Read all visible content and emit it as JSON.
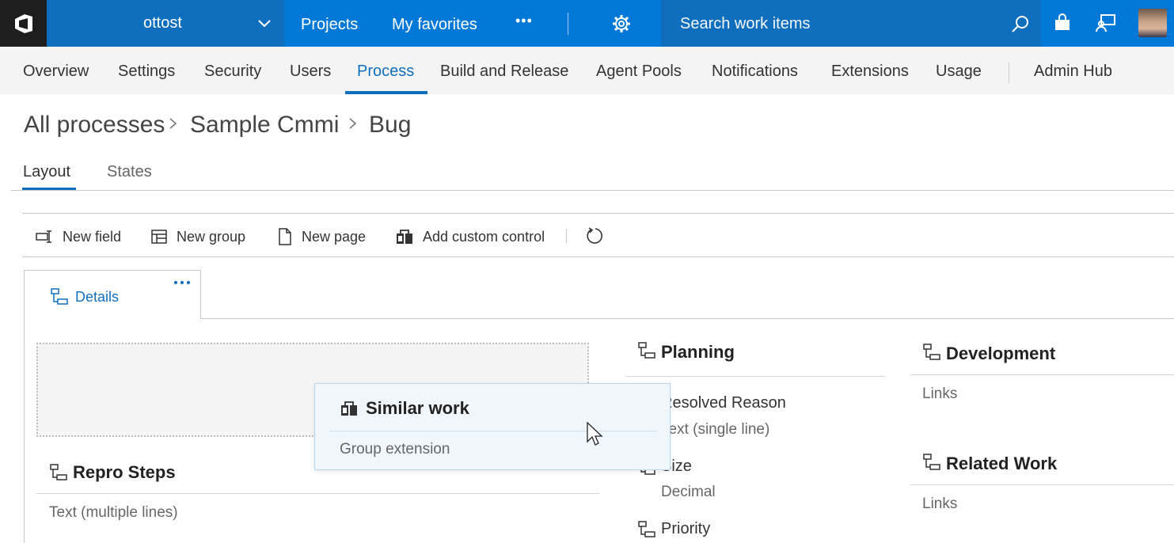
{
  "topbar": {
    "account_name": "ottost",
    "nav": {
      "projects": "Projects",
      "favorites": "My favorites",
      "more": "•••"
    },
    "search_placeholder": "Search work items",
    "accent_color": "#0078d7"
  },
  "hubs": {
    "items": [
      "Overview",
      "Settings",
      "Security",
      "Users",
      "Process",
      "Build and Release",
      "Agent Pools",
      "Notifications",
      "Extensions",
      "Usage"
    ],
    "active": "Process",
    "admin_hub": "Admin Hub"
  },
  "breadcrumb": {
    "root": "All processes",
    "process": "Sample Cmmi",
    "wit": "Bug"
  },
  "pivots": {
    "layout": "Layout",
    "states": "States"
  },
  "toolbar": {
    "new_field": "New field",
    "new_group": "New group",
    "new_page": "New page",
    "add_custom_control": "Add custom control"
  },
  "page_tab": {
    "label": "Details"
  },
  "groups": {
    "repro_steps": {
      "title": "Repro Steps",
      "type": "Text (multiple lines)"
    },
    "planning": {
      "title": "Planning",
      "fields": [
        {
          "name": "Resolved Reason",
          "type": "Text (single line)"
        },
        {
          "name": "Size",
          "type": "Decimal"
        },
        {
          "name": "Priority"
        }
      ]
    },
    "development": {
      "title": "Development",
      "links": "Links"
    },
    "related_work": {
      "title": "Related Work",
      "links": "Links"
    }
  },
  "drag_card": {
    "title": "Similar work",
    "subtitle": "Group extension"
  }
}
